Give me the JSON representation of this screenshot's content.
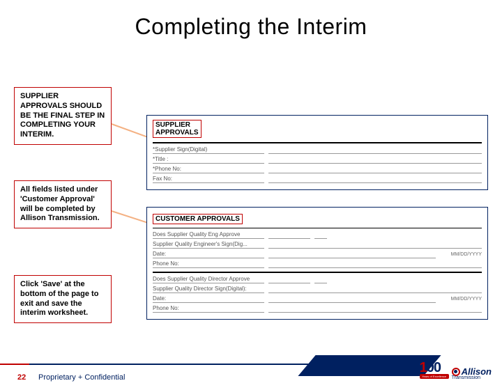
{
  "title": "Completing the Interim",
  "callouts": {
    "c1": "SUPPLIER APPROVALS SHOULD BE THE FINAL STEP IN COMPLETING YOUR INTERIM.",
    "c2": "All fields listed under 'Customer Approval' will be completed by Allison Transmission.",
    "c3": "Click 'Save' at the bottom of the page to exit and save the interim worksheet."
  },
  "form1": {
    "header_l1": "SUPPLIER",
    "header_l2": "APPROVALS",
    "rows": [
      "*Supplier Sign(Digital)",
      "*Title :",
      "*Phone No:",
      "Fax No:"
    ]
  },
  "form2": {
    "header": "CUSTOMER APPROVALS",
    "q1": "Does Supplier Quality Eng Approve",
    "r1": "Supplier Quality Engineer's Sign(Dig...",
    "r2": "Date:",
    "r3": "Phone No:",
    "q2": "Does Supplier Quality Director Approve",
    "r4": "Supplier Quality Director Sign(Digital):",
    "r5": "Date:",
    "r6": "Phone No:",
    "date_fmt": "MM/DD/YYYY"
  },
  "footer": {
    "page": "22",
    "confidential": "Proprietary + Confidential",
    "logo_years": "Years of Excellence",
    "logo_brand": "Allison",
    "logo_sub": "Transmission"
  }
}
